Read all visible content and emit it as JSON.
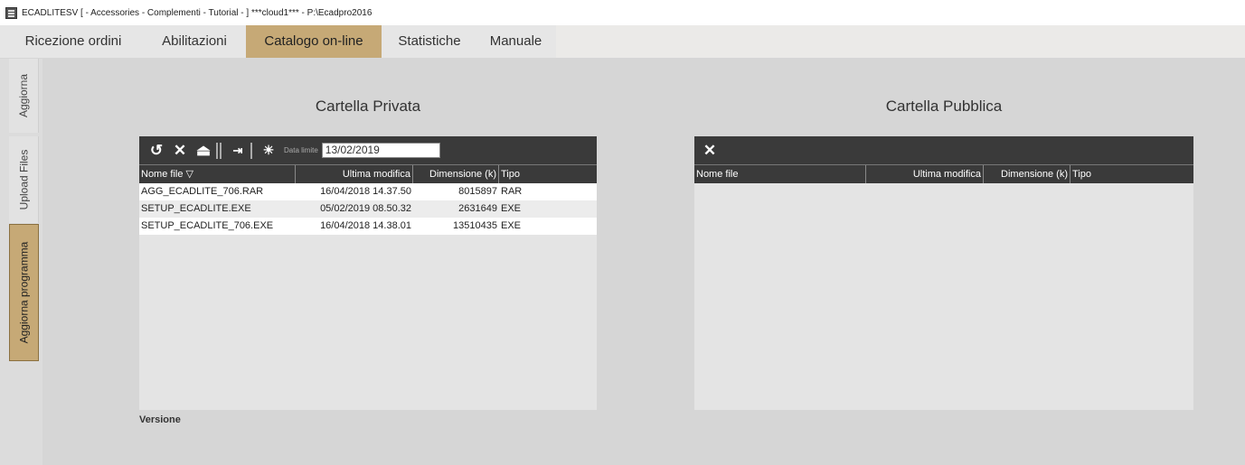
{
  "window": {
    "title": "ECADLITESV [ - Accessories - Complementi - Tutorial - ] ***cloud1*** - P:\\Ecadpro2016",
    "app_icon": "app-icon"
  },
  "tabs": [
    {
      "label": "Ricezione ordini",
      "active": false
    },
    {
      "label": "Abilitazioni",
      "active": false
    },
    {
      "label": "Catalogo on-line",
      "active": true
    },
    {
      "label": "Statistiche",
      "active": false
    },
    {
      "label": "Manuale",
      "active": false
    }
  ],
  "side_tabs": [
    {
      "label": "Aggiorna",
      "active": false
    },
    {
      "label": "Upload Files",
      "active": false
    },
    {
      "label": "Aggiorna programma",
      "active": true
    }
  ],
  "private_folder": {
    "title": "Cartella Privata",
    "toolbar": {
      "icons": [
        "refresh-icon",
        "delete-icon",
        "download-icon",
        "transfer-icon",
        "lightbulb-icon"
      ],
      "date_label": "Data limite",
      "date_value": "13/02/2019"
    },
    "columns": {
      "name": "Nome file",
      "sort_indicator": "▽",
      "modified": "Ultima modifica",
      "size": "Dimensione (k)",
      "type": "Tipo"
    },
    "rows": [
      {
        "name": "AGG_ECADLITE_706.RAR",
        "modified": "16/04/2018 14.37.50",
        "size": "8015897",
        "type": "RAR"
      },
      {
        "name": "SETUP_ECADLITE.EXE",
        "modified": "05/02/2019 08.50.32",
        "size": "2631649",
        "type": "EXE"
      },
      {
        "name": "SETUP_ECADLITE_706.EXE",
        "modified": "16/04/2018 14.38.01",
        "size": "13510435",
        "type": "EXE"
      }
    ],
    "footer_label": "Versione"
  },
  "public_folder": {
    "title": "Cartella Pubblica",
    "toolbar": {
      "icons": [
        "delete-icon"
      ]
    },
    "columns": {
      "name": "Nome file",
      "modified": "Ultima modifica",
      "size": "Dimensione (k)",
      "type": "Tipo"
    },
    "rows": []
  },
  "colors": {
    "accent": "#c6a976",
    "toolbar": "#3a3a3a",
    "background": "#d6d6d6"
  }
}
